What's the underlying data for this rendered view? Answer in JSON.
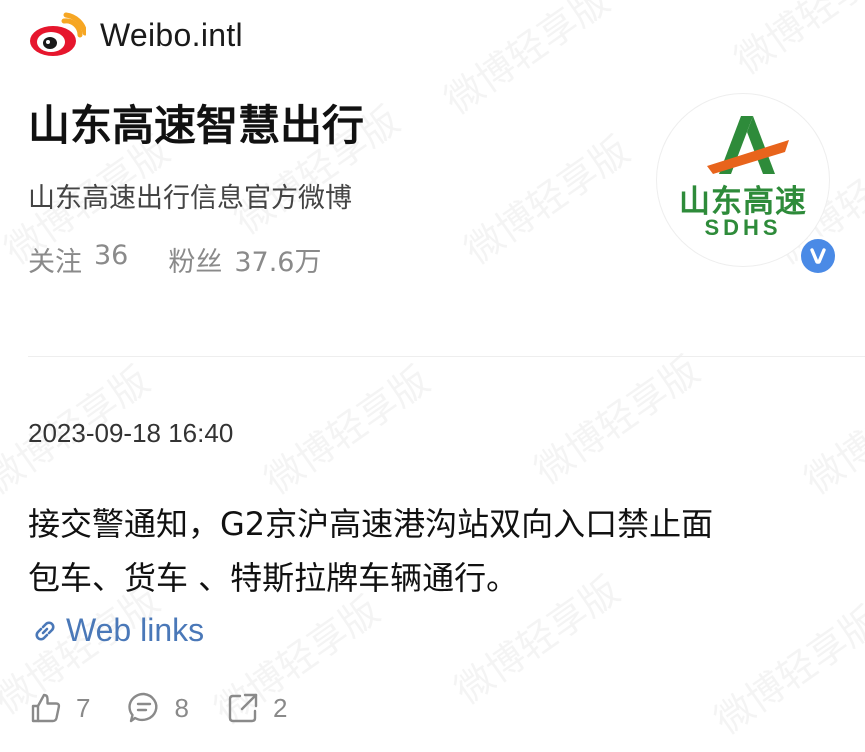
{
  "app": {
    "brand": "Weibo.intl",
    "watermark": "微博轻享版"
  },
  "profile": {
    "name": "山东高速智慧出行",
    "description": "山东高速出行信息官方微博",
    "following_label": "关注",
    "following_count": "36",
    "followers_label": "粉丝",
    "followers_count": "37.6万",
    "avatar": {
      "text_cn": "山东高速",
      "text_en": "SDHS",
      "verified_icon": "verified-v-icon",
      "brand_green": "#2e8b3a",
      "brand_orange": "#e8641c"
    }
  },
  "post": {
    "timestamp": "2023-09-18 16:40",
    "text_lines": [
      "接交警通知，G2京沪高速港沟站双向入口禁止面",
      "包车、货车 、特斯拉牌车辆通行。"
    ],
    "link_label": "Web links",
    "link_icon": "link-icon"
  },
  "actions": {
    "like": {
      "icon": "thumbs-up-icon",
      "count": "7"
    },
    "comment": {
      "icon": "comment-icon",
      "count": "8"
    },
    "share": {
      "icon": "share-icon",
      "count": "2"
    }
  },
  "colors": {
    "link": "#4a78b8",
    "muted": "#8a8a8a",
    "verified": "#4a8ae6",
    "weibo_red": "#e6162d",
    "weibo_orange": "#f6a623"
  }
}
